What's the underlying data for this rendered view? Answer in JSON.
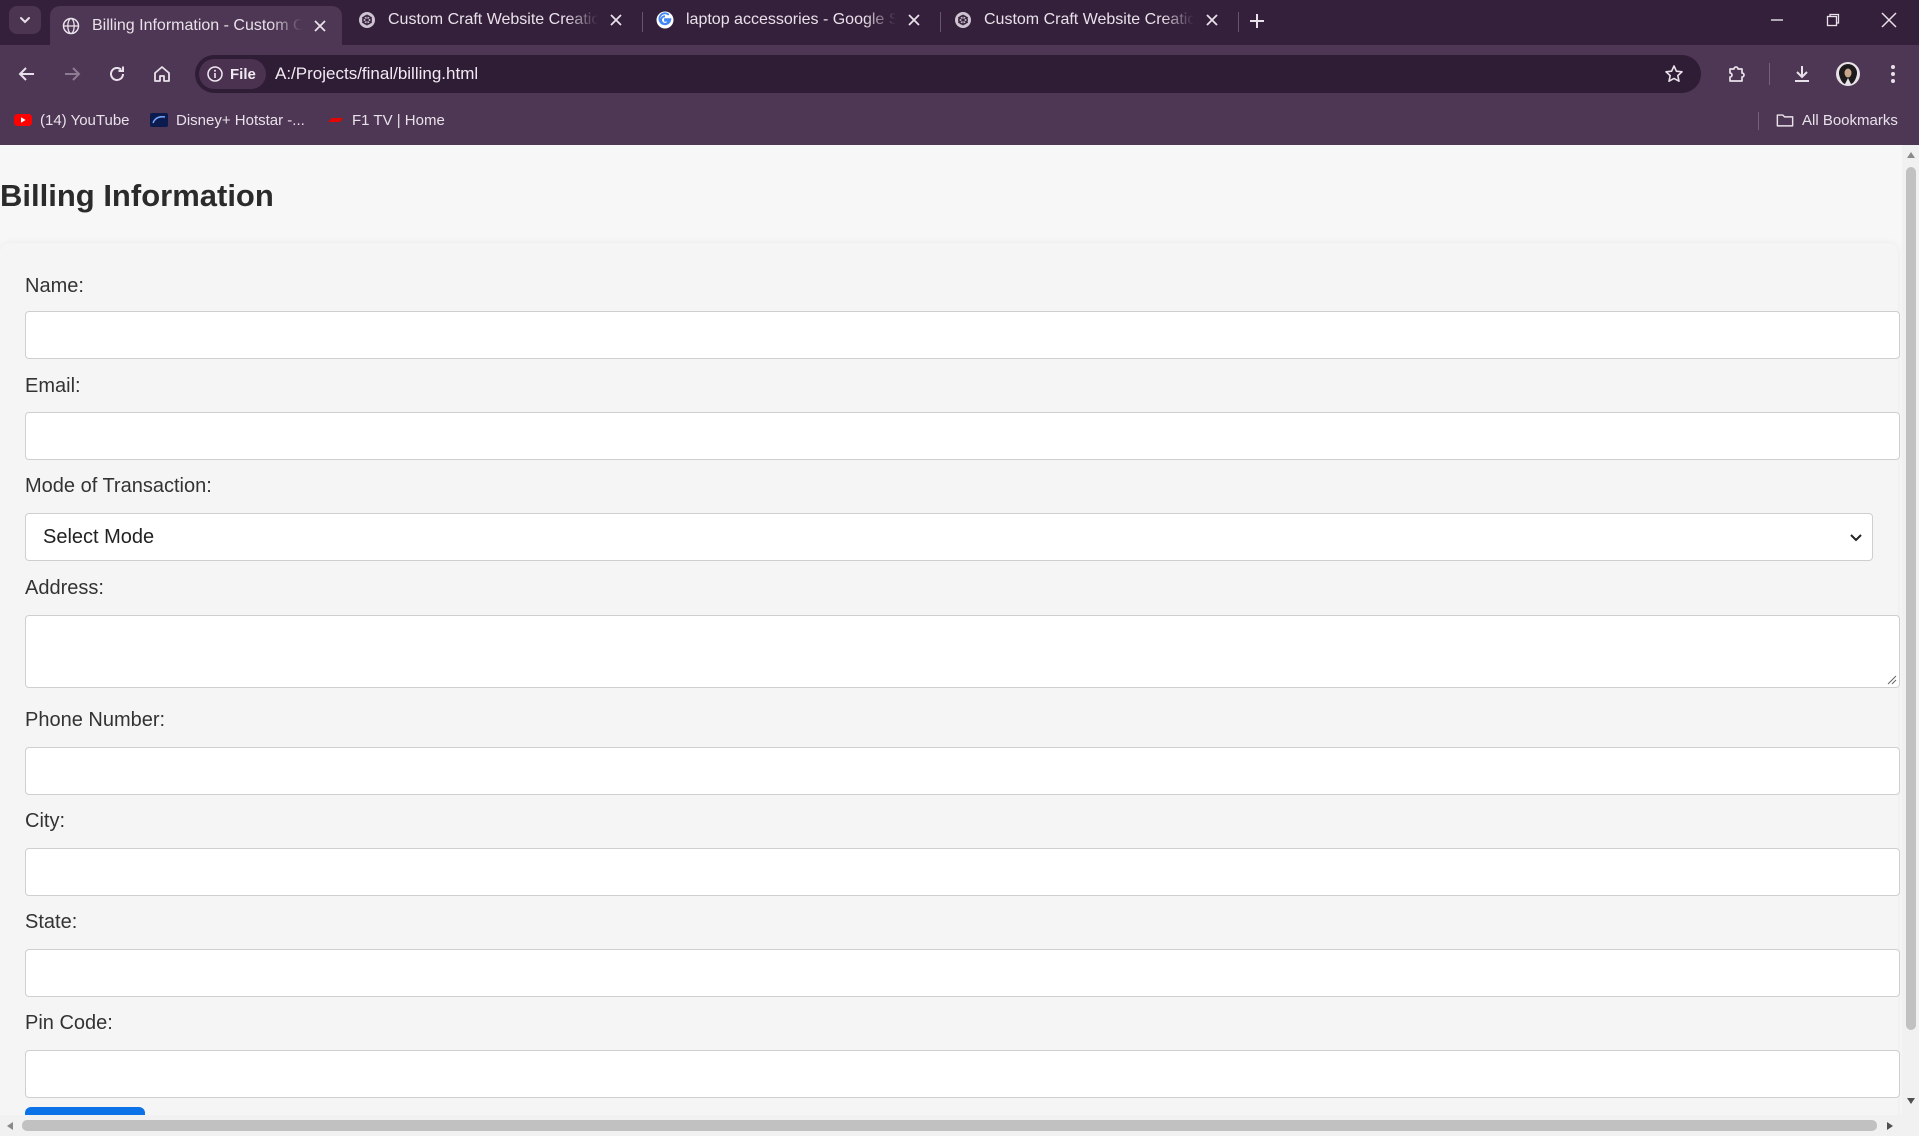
{
  "browser": {
    "tabs": [
      {
        "title": "Billing Information - Custom Craft Website Creation",
        "active": true,
        "favicon": "globe-icon"
      },
      {
        "title": "Custom Craft Website Creation",
        "active": false,
        "favicon": "chatgpt-icon"
      },
      {
        "title": "laptop accessories - Google Search",
        "active": false,
        "favicon": "google-icon"
      },
      {
        "title": "Custom Craft Website Creation",
        "active": false,
        "favicon": "chatgpt-icon"
      }
    ],
    "site_chip_label": "File",
    "url": "A:/Projects/final/billing.html",
    "bookmarks": [
      {
        "label": "(14) YouTube",
        "icon": "youtube-icon"
      },
      {
        "label": "Disney+ Hotstar -...",
        "icon": "hotstar-icon"
      },
      {
        "label": "F1 TV | Home",
        "icon": "f1-icon"
      }
    ],
    "all_bookmarks_label": "All Bookmarks"
  },
  "page": {
    "title": "Billing Information",
    "form": {
      "name_label": "Name:",
      "email_label": "Email:",
      "mode_label": "Mode of Transaction:",
      "mode_selected": "Select Mode",
      "address_label": "Address:",
      "phone_label": "Phone Number:",
      "city_label": "City:",
      "state_label": "State:",
      "pin_label": "Pin Code:"
    }
  },
  "colors": {
    "tabstrip_bg": "#35203b",
    "toolbar_bg": "#4e3754",
    "page_bg": "#f7f7f7",
    "submit_button": "#0b72e8"
  }
}
